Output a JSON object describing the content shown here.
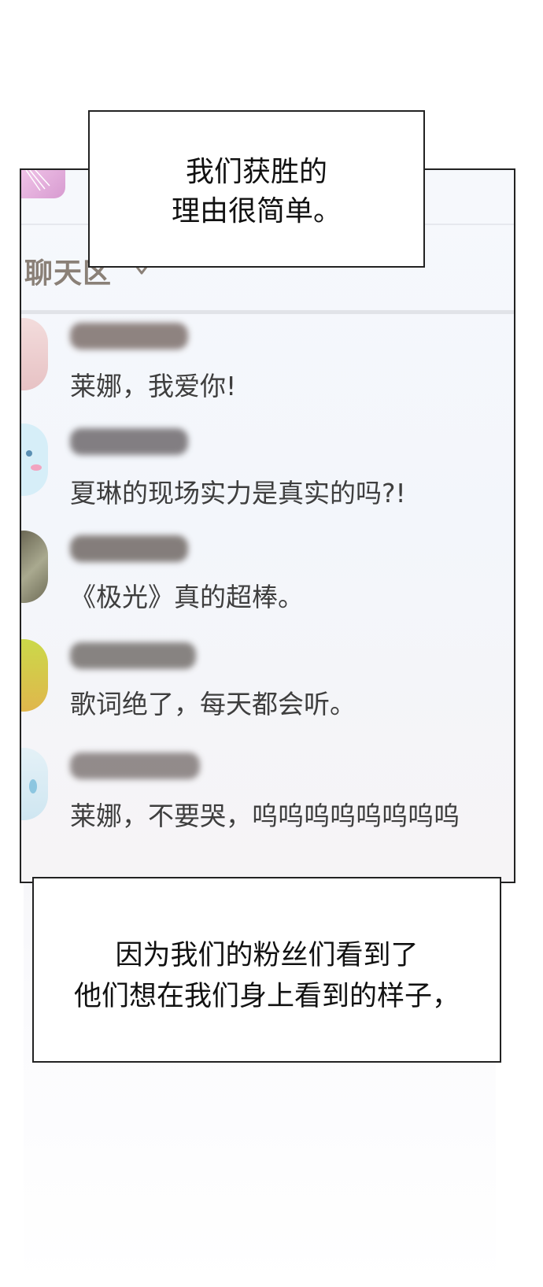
{
  "caption_top": {
    "lines": [
      "我们获胜的",
      "理由很简单。"
    ]
  },
  "caption_bottom": {
    "lines": [
      "因为我们的粉丝们看到了",
      "他们想在我们身上看到的样子，"
    ]
  },
  "chat": {
    "title": "聊天区",
    "chevron_icon": "chevron-down-icon",
    "messages": [
      {
        "text": "莱娜，我爱你!",
        "avatar_color": "#f0d6d6"
      },
      {
        "text": "夏琳的现场实力是真实的吗?!",
        "avatar_color": "#d3ecf6"
      },
      {
        "text": "《极光》真的超棒。",
        "avatar_color": "#8e8f7c"
      },
      {
        "text": "歌词绝了，每天都会听。",
        "avatar_color": "#c4d447"
      },
      {
        "text": "莱娜，不要哭，呜呜呜呜呜呜呜呜",
        "avatar_color": "#dbeef6"
      }
    ]
  },
  "colors": {
    "caption_border": "#222222",
    "chat_title": "#8a8077",
    "message_text": "#3e3e3e",
    "blurred_nickname": "#7d6f6b"
  }
}
